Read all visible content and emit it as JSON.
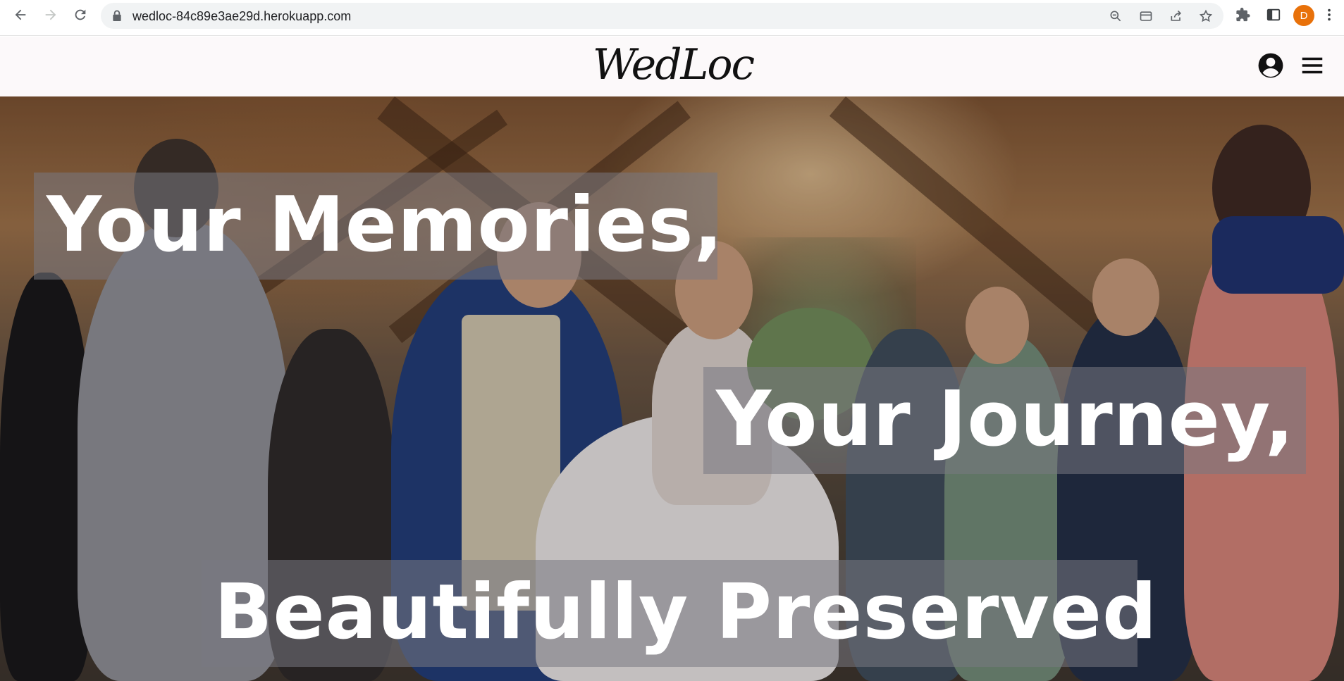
{
  "browser": {
    "url": "wedloc-84c89e3ae29d.herokuapp.com",
    "profile_initial": "D",
    "profile_color": "#e8710a",
    "icons": {
      "back": "back-arrow-icon",
      "forward": "forward-arrow-icon",
      "reload": "reload-icon",
      "lock": "lock-icon",
      "zoom": "zoom-icon",
      "card": "card-icon",
      "share": "share-icon",
      "bookmark": "star-icon",
      "extensions": "puzzle-icon",
      "sidepanel": "side-panel-icon",
      "menu": "kebab-menu-icon"
    }
  },
  "site": {
    "logo_text": "WedLoc",
    "header_bg": "#fcf9fa",
    "icons": {
      "account": "account-circle-icon",
      "menu": "hamburger-menu-icon"
    }
  },
  "hero": {
    "line1": "Your Memories,",
    "line2": "Your Journey,",
    "line3": "Beautifully Preserved"
  }
}
